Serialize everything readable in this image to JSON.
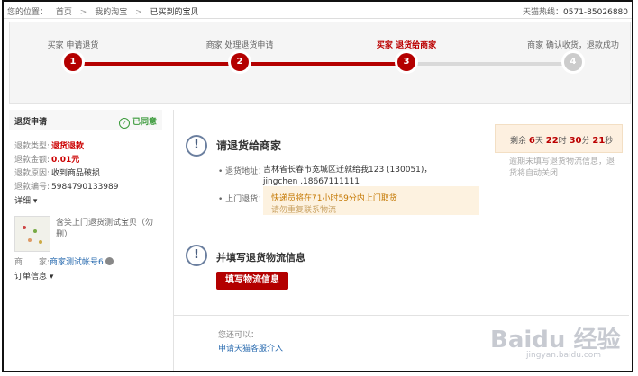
{
  "breadcrumb": {
    "prefix": "您的位置：",
    "items": [
      "首页",
      "我的淘宝",
      "已买到的宝贝"
    ],
    "separator": ">"
  },
  "hotline": {
    "label": "天猫热线：",
    "number": "0571-85026880"
  },
  "steps": [
    {
      "label": "买家 申请退货",
      "num": "1",
      "state": "done"
    },
    {
      "label": "商家 处理退货申请",
      "num": "2",
      "state": "done"
    },
    {
      "label": "买家 退货给商家",
      "num": "3",
      "state": "current"
    },
    {
      "label": "商家 确认收货，退款成功",
      "num": "4",
      "state": "pending"
    }
  ],
  "sidebar": {
    "title": "退货申请",
    "status": "已同意",
    "fields": [
      {
        "label": "退款类型:",
        "value": "退货退款"
      },
      {
        "label": "退款金额:",
        "value": "0.01元"
      },
      {
        "label": "退款原因:",
        "value": "收到商品破损"
      },
      {
        "label": "退款编号:",
        "value": "5984790133989"
      }
    ],
    "detail": "详细 ▾",
    "product_title": "含笑上门退货测试宝贝（勿删）",
    "merchant_label": "商　　家:",
    "merchant_name": "商家测试帐号6",
    "order_info": "订单信息 ▾"
  },
  "main": {
    "title1": "请退货给商家",
    "address_label": "• 退货地址：",
    "address": "吉林省长春市宽城区迁就给我123 (130051)，jingchen ,18667111111",
    "door_label": "• 上门退货：",
    "door_line1": "快递员将在71小时59分内上门取货",
    "door_line2": "请勿重复联系物流",
    "title2": "并填写退货物流信息",
    "button": "填写物流信息",
    "cando": "您还可以：",
    "link": "申请天猫客服介入"
  },
  "timer": {
    "prefix": "剩余",
    "days": "6",
    "days_unit": "天",
    "hours": "22",
    "hours_unit": "时",
    "minutes": "30",
    "minutes_unit": "分",
    "seconds": "21",
    "seconds_unit": "秒",
    "note": "逾期未填写退货物流信息，退货将自动关闭"
  },
  "watermark": {
    "text": "Baidu 经验",
    "sub": "jingyan.baidu.com"
  },
  "colors": {
    "accent": "#b40000",
    "link": "#2b6cb0",
    "success": "#3a9a3a"
  }
}
